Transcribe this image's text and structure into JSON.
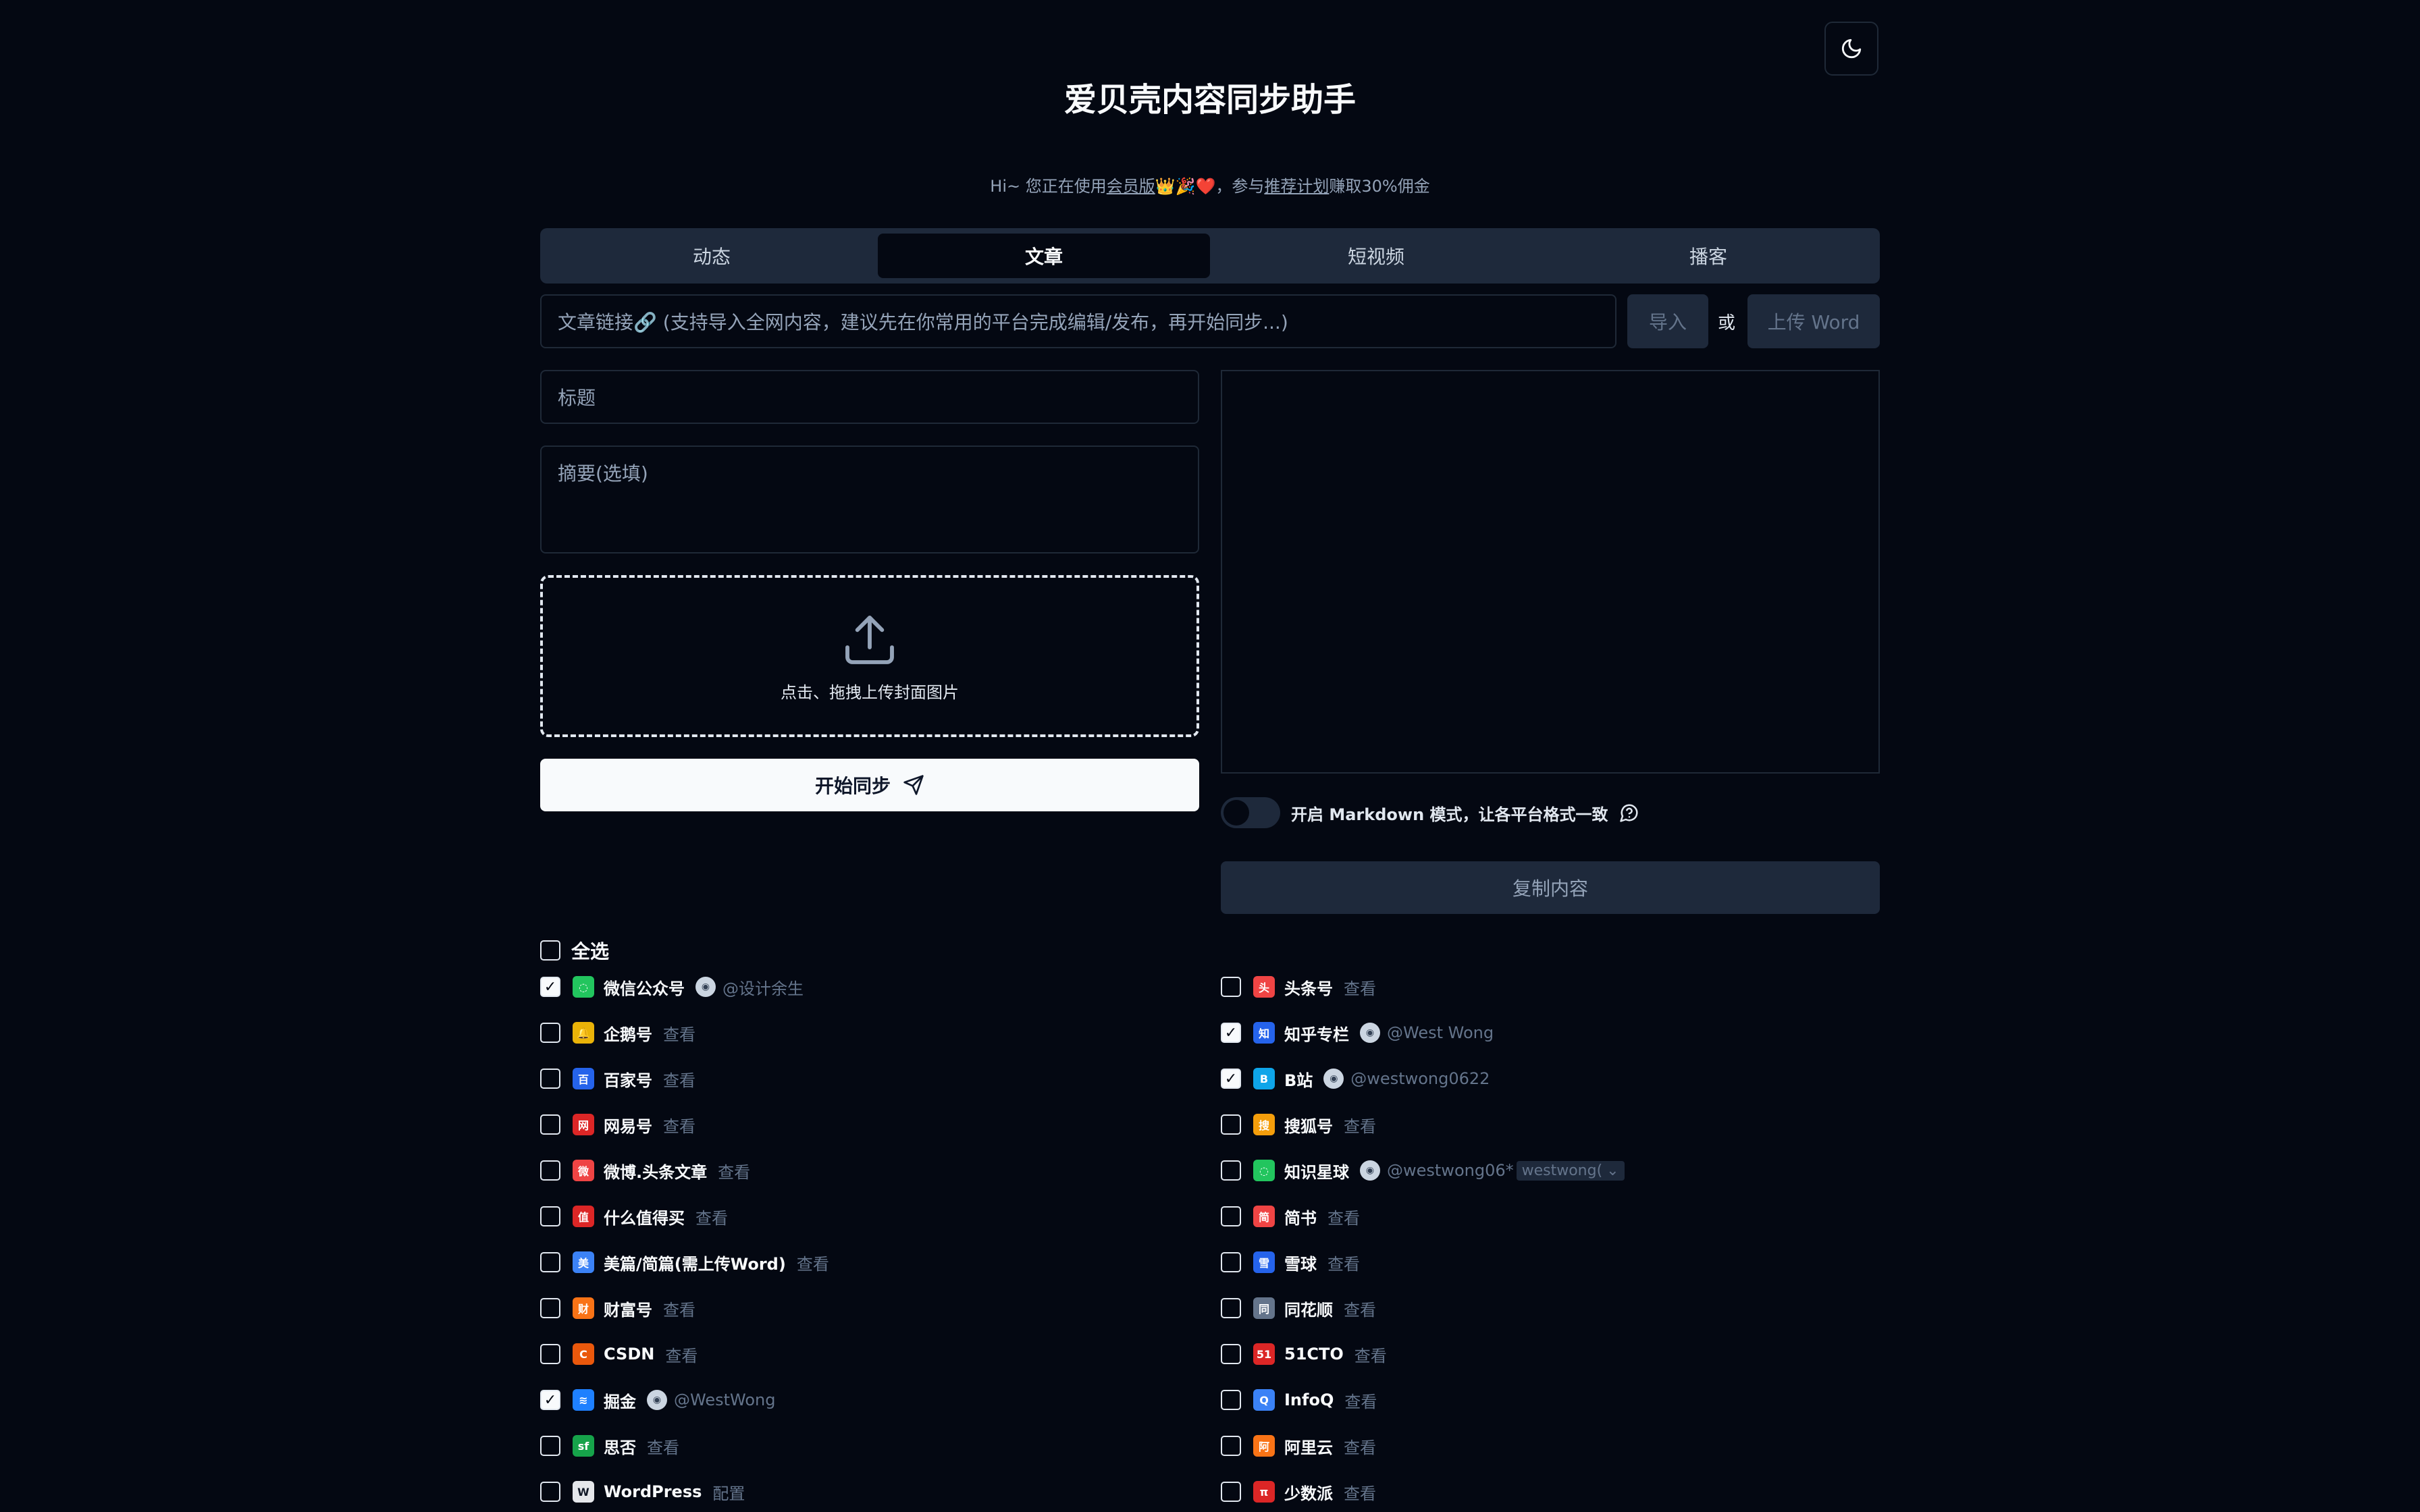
{
  "header": {
    "title": "爱贝壳内容同步助手",
    "subtitle_prefix": "Hi~ 您正在使用",
    "membership_link": "会员版",
    "subtitle_emojis": "👑🎉❤️",
    "subtitle_mid": "，参与",
    "referral_link": "推荐计划",
    "subtitle_suffix": "赚取30%佣金"
  },
  "tabs": [
    {
      "label": "动态",
      "active": false
    },
    {
      "label": "文章",
      "active": true
    },
    {
      "label": "短视频",
      "active": false
    },
    {
      "label": "播客",
      "active": false
    }
  ],
  "import": {
    "url_placeholder": "文章链接🔗 (支持导入全网内容，建议先在你常用的平台完成编辑/发布，再开始同步...)",
    "import_label": "导入",
    "or_label": "或",
    "upload_word_label": "上传 Word"
  },
  "form": {
    "title_placeholder": "标题",
    "summary_placeholder": "摘要(选填)",
    "cover_upload_label": "点击、拖拽上传封面图片",
    "sync_button_label": "开始同步"
  },
  "editor": {
    "markdown_label": "开启 Markdown 模式，让各平台格式一致",
    "copy_button_label": "复制内容"
  },
  "select_all_label": "全选",
  "platforms_left": [
    {
      "name": "微信公众号",
      "checked": true,
      "icon_color": "#22c55e",
      "glyph": "◌",
      "account": "@设计余生"
    },
    {
      "name": "企鹅号",
      "checked": false,
      "icon_color": "#eab308",
      "glyph": "🔔",
      "action": "查看"
    },
    {
      "name": "百家号",
      "checked": false,
      "icon_color": "#2563eb",
      "glyph": "百",
      "action": "查看"
    },
    {
      "name": "网易号",
      "checked": false,
      "icon_color": "#dc2626",
      "glyph": "网",
      "action": "查看"
    },
    {
      "name": "微博.头条文章",
      "checked": false,
      "icon_color": "#ef4444",
      "glyph": "微",
      "action": "查看"
    },
    {
      "name": "什么值得买",
      "checked": false,
      "icon_color": "#dc2626",
      "glyph": "值",
      "action": "查看"
    },
    {
      "name": "美篇/简篇(需上传Word)",
      "checked": false,
      "icon_color": "#3b82f6",
      "glyph": "美",
      "action": "查看"
    },
    {
      "name": "财富号",
      "checked": false,
      "icon_color": "#f97316",
      "glyph": "财",
      "action": "查看"
    },
    {
      "name": "CSDN",
      "checked": false,
      "icon_color": "#ea580c",
      "glyph": "C",
      "action": "查看"
    },
    {
      "name": "掘金",
      "checked": true,
      "icon_color": "#1e80ff",
      "glyph": "≋",
      "account": "@WestWong"
    },
    {
      "name": "思否",
      "checked": false,
      "icon_color": "#16a34a",
      "glyph": "sf",
      "action": "查看"
    },
    {
      "name": "WordPress",
      "checked": false,
      "icon_color": "#e5e7eb",
      "glyph": "W",
      "action": "配置"
    }
  ],
  "platforms_right": [
    {
      "name": "头条号",
      "checked": false,
      "icon_color": "#ef4444",
      "glyph": "头",
      "action": "查看"
    },
    {
      "name": "知乎专栏",
      "checked": true,
      "icon_color": "#2563eb",
      "glyph": "知",
      "account": "@West Wong"
    },
    {
      "name": "B站",
      "checked": true,
      "icon_color": "#0ea5e9",
      "glyph": "B",
      "account": "@westwong0622"
    },
    {
      "name": "搜狐号",
      "checked": false,
      "icon_color": "#f59e0b",
      "glyph": "搜",
      "action": "查看"
    },
    {
      "name": "知识星球",
      "checked": false,
      "icon_color": "#22c55e",
      "glyph": "◌",
      "account": "@westwong06*",
      "selector": "westwong("
    },
    {
      "name": "简书",
      "checked": false,
      "icon_color": "#ef4444",
      "glyph": "简",
      "action": "查看"
    },
    {
      "name": "雪球",
      "checked": false,
      "icon_color": "#2563eb",
      "glyph": "雪",
      "action": "查看"
    },
    {
      "name": "同花顺",
      "checked": false,
      "icon_color": "#64748b",
      "glyph": "同",
      "action": "查看"
    },
    {
      "name": "51CTO",
      "checked": false,
      "icon_color": "#dc2626",
      "glyph": "51",
      "action": "查看"
    },
    {
      "name": "InfoQ",
      "checked": false,
      "icon_color": "#3b82f6",
      "glyph": "Q",
      "action": "查看"
    },
    {
      "name": "阿里云",
      "checked": false,
      "icon_color": "#f97316",
      "glyph": "阿",
      "action": "查看"
    },
    {
      "name": "少数派",
      "checked": false,
      "icon_color": "#dc2626",
      "glyph": "π",
      "action": "查看"
    }
  ]
}
